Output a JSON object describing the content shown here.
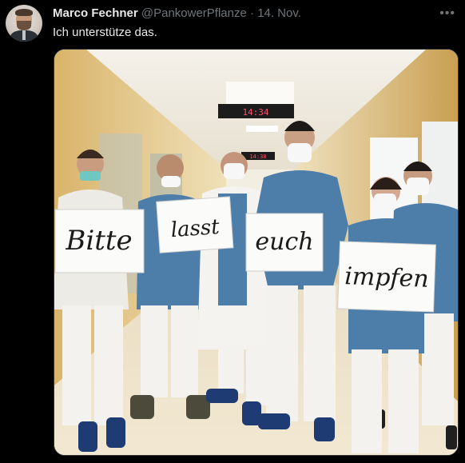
{
  "tweet": {
    "author_name": "Marco Fechner",
    "handle": "@PankowerPflanze",
    "separator": "·",
    "date": "14. Nov.",
    "text": "Ich unterstütze das.",
    "more_icon": "more-dots-icon"
  },
  "photo": {
    "clock_main": "14:34",
    "clock_far": "14:38",
    "signs": [
      "Bitte",
      "lasst",
      "euch",
      "impfen"
    ]
  },
  "colors": {
    "background": "#000000",
    "text_primary": "#e7e9ea",
    "text_secondary": "#71767b",
    "scrubs": "#4d7eaa"
  }
}
